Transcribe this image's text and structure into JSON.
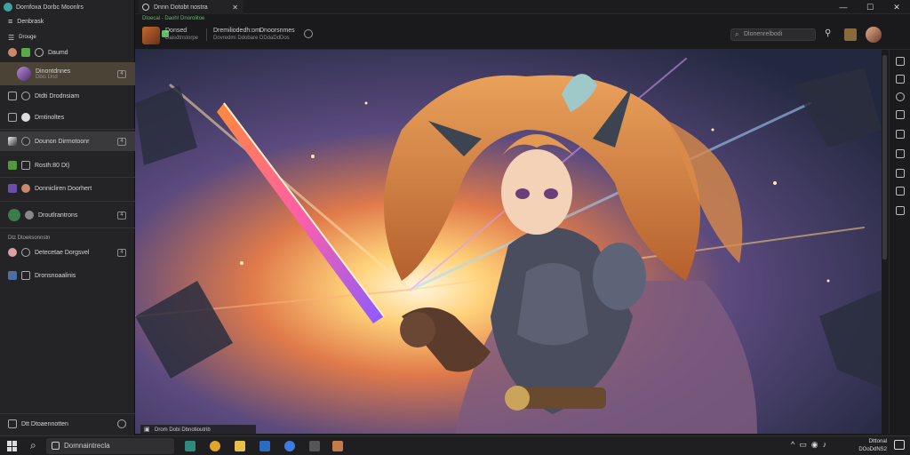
{
  "app": {
    "title": "Dornfoxa Dorbc Moonlrs"
  },
  "sidebar": {
    "home": "Denbrask",
    "section_label": "Drouge",
    "top_item": "Daumd",
    "items": [
      {
        "label": "Dinontdnnes",
        "sub": "Dbis Dnd",
        "active": true,
        "badge": "4"
      },
      {
        "label": "Dtdti Drodnsiam",
        "sub": ""
      },
      {
        "label": "Dmtinoltes",
        "sub": ""
      },
      {
        "label": "Dounon Dirrnotoonr",
        "sub": "",
        "selected": true,
        "badge": "4"
      },
      {
        "label": "Rosth:80 Dt)",
        "sub": ""
      },
      {
        "label": "Donnicliren Doorhert",
        "sub": ""
      },
      {
        "label": "Droutlrantrons",
        "sub": "",
        "badge": "4"
      }
    ],
    "group_label": "Dtz Dtoeksonnstn",
    "group_items": [
      {
        "label": "Detecetae Dorgsvel",
        "badge": "4"
      },
      {
        "label": "Dronsnoaalinis"
      }
    ],
    "footer": "Dtt Dtoaennotten"
  },
  "titlebar": {
    "tab": "Dnnn Dotobt nostra"
  },
  "header": {
    "breadcrumb": "Dloecal - Daoh! Dnorolitoe",
    "name": "Donsed",
    "name_sub": "Daisdtnstorpe",
    "info1": "Dremiliodedh:om",
    "info1_sub": "Dovredmi Ddobare",
    "info2": "Dnoorsnmes",
    "info2_sub": "DDdaDdDos",
    "search": "Dlonenrelbodi"
  },
  "image": {
    "overlay": "Drom Dobi Dbnotioutrib"
  },
  "taskbar": {
    "search": "Domnaintrecla",
    "time": "Dlttonal",
    "date": "DOoDdNS2"
  },
  "colors": {
    "accent": "#3aa7a0",
    "active_bg": "#4a4336",
    "green": "#5fbf6a"
  }
}
